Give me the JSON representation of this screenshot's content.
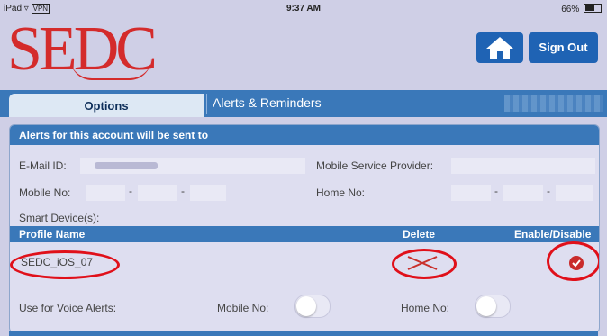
{
  "status_bar": {
    "device": "iPad",
    "network": "VPN",
    "time": "9:37 AM",
    "battery": "66%"
  },
  "header": {
    "logo_text": "SEDC",
    "sign_out_label": "Sign Out"
  },
  "tabs": [
    {
      "label": "Options",
      "active": true
    },
    {
      "label": "Alerts & Reminders",
      "active": false
    }
  ],
  "panel": {
    "title": "Alerts for this account will be sent to",
    "email_label": "E-Mail ID:",
    "mobile_provider_label": "Mobile Service Provider:",
    "mobile_label": "Mobile No:",
    "home_label": "Home No:",
    "smart_devices_label": "Smart Device(s):",
    "phone_separator": "-"
  },
  "devices_table": {
    "columns": {
      "profile": "Profile Name",
      "delete": "Delete",
      "enable": "Enable/Disable"
    },
    "rows": [
      {
        "profile_name": "SEDC_iOS_07",
        "enabled": true
      }
    ]
  },
  "voice_alerts": {
    "label": "Use for Voice Alerts:",
    "mobile_label": "Mobile No:",
    "home_label": "Home No:",
    "mobile_on": false,
    "home_on": false
  },
  "colors": {
    "accent_blue": "#3a78b9",
    "logo_red": "#d42b2b",
    "highlight_red": "#e0101a",
    "background": "#cfcfe6"
  },
  "icons": [
    "wifi-icon",
    "home-icon",
    "delete-x-icon",
    "checkmark-icon",
    "battery-icon"
  ]
}
